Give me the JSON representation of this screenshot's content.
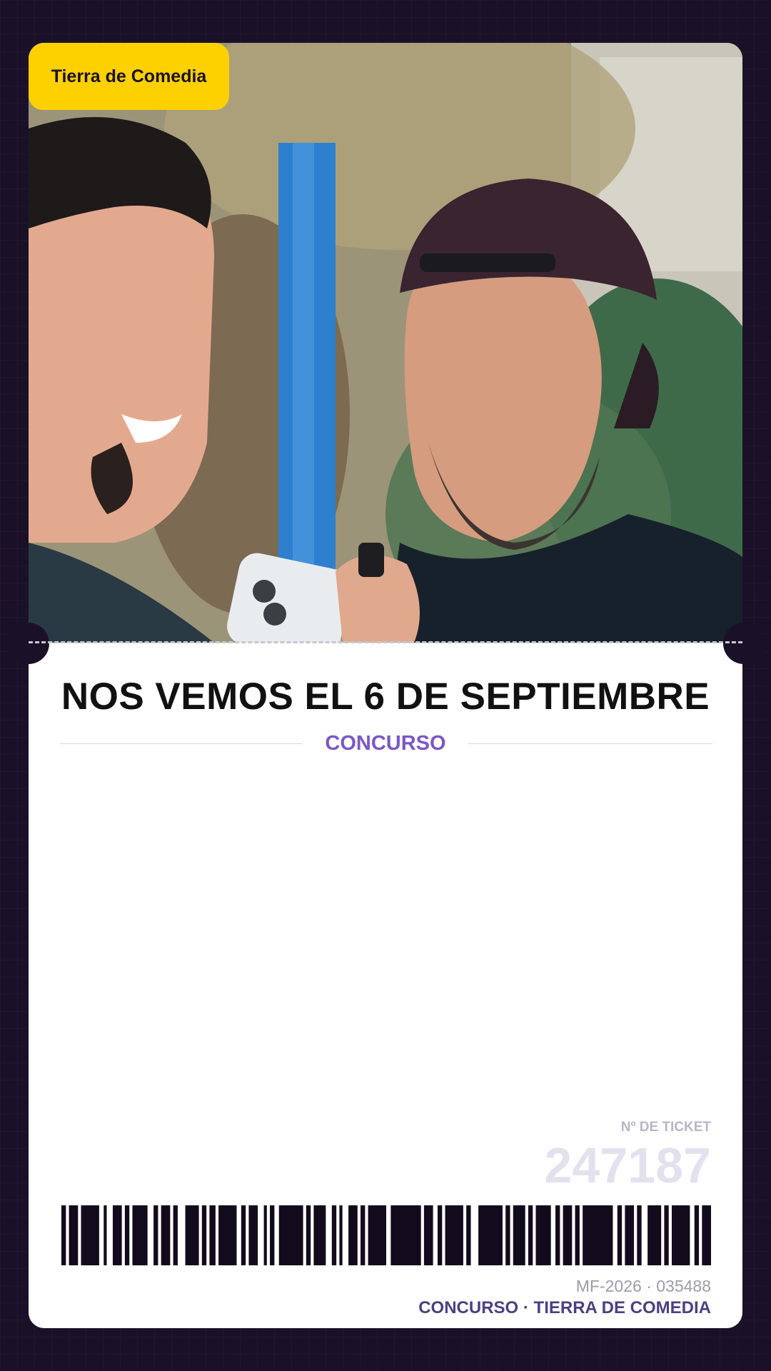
{
  "brand": {
    "label": "Tierra de Comedia",
    "color": "#fdd000"
  },
  "headline": "NOS VEMOS EL 6 DE SEPTIEMBRE",
  "category": "CONCURSO",
  "ticket": {
    "label": "Nº DE TICKET",
    "number": "247187"
  },
  "serial": "MF-2026 · 035488",
  "footer": "CONCURSO · TIERRA DE COMEDIA",
  "colors": {
    "background": "#1a1128",
    "accent": "#7a57c9",
    "footer_text": "#4d3f82"
  },
  "icons": {
    "barcode": "barcode-graphic",
    "photo": "two-men-street-interview-photo"
  }
}
